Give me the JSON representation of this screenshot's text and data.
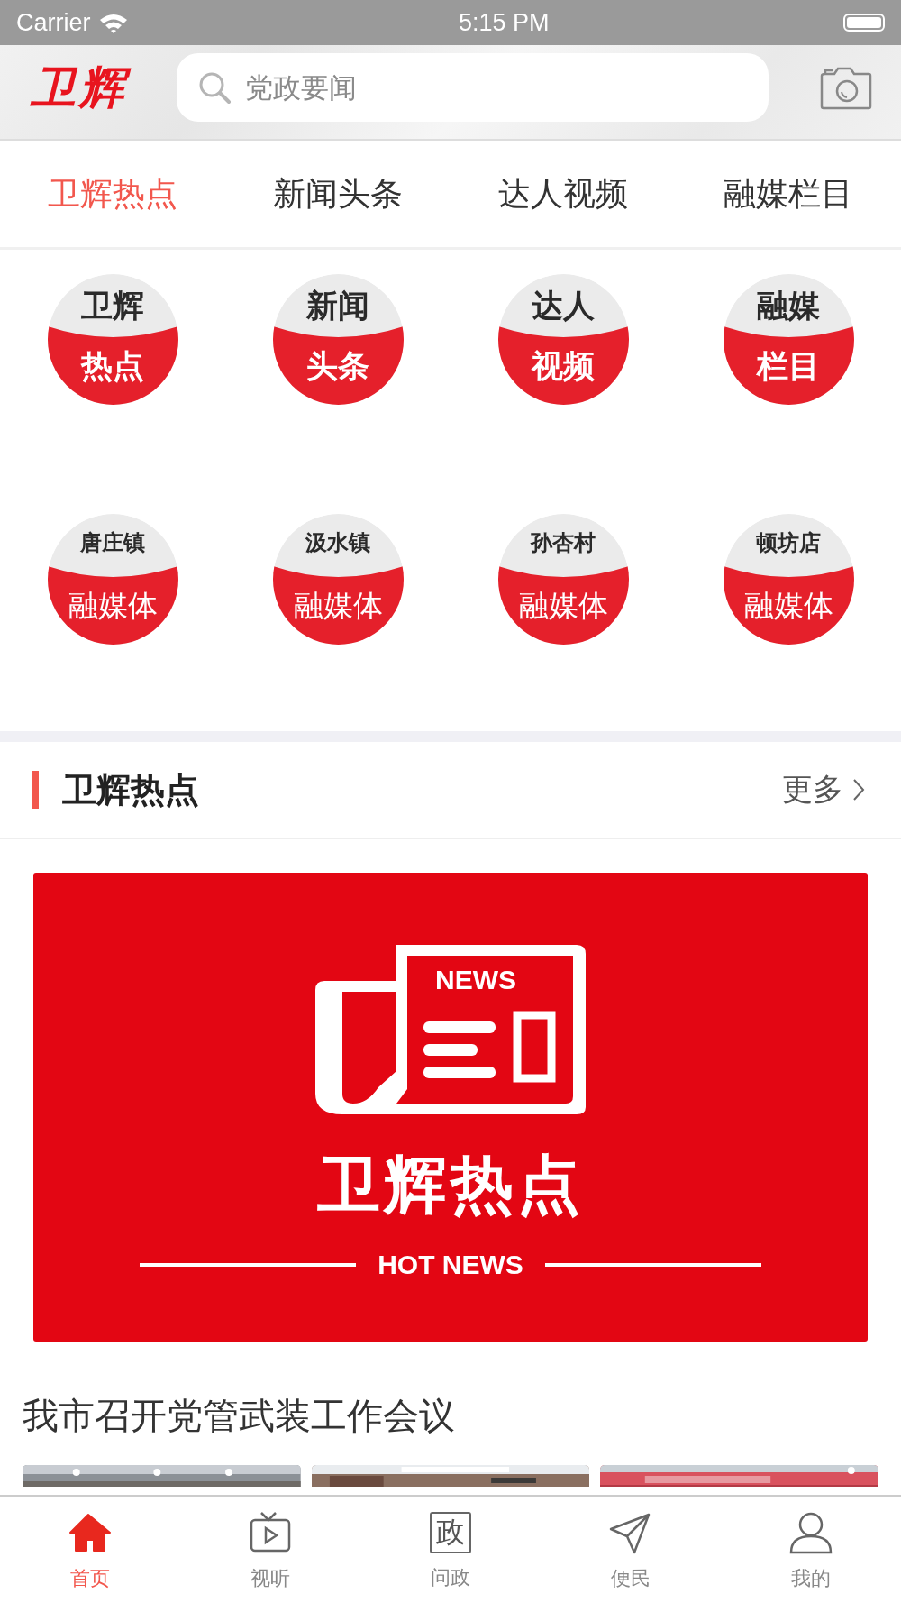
{
  "status_bar": {
    "carrier": "Carrier",
    "time": "5:15 PM"
  },
  "header": {
    "logo": "卫辉",
    "search": {
      "placeholder": "党政要闻"
    }
  },
  "tabs": [
    {
      "label": "卫辉热点",
      "selected": true
    },
    {
      "label": "新闻头条",
      "selected": false
    },
    {
      "label": "达人视频",
      "selected": false
    },
    {
      "label": "融媒栏目",
      "selected": false
    }
  ],
  "channels": [
    {
      "kind": "column",
      "top": "卫辉",
      "bottom": "热点"
    },
    {
      "kind": "column",
      "top": "新闻",
      "bottom": "头条"
    },
    {
      "kind": "column",
      "top": "达人",
      "bottom": "视频"
    },
    {
      "kind": "column",
      "top": "融媒",
      "bottom": "栏目"
    },
    {
      "kind": "town",
      "top": "唐庄镇",
      "bottom": "融媒体"
    },
    {
      "kind": "town",
      "top": "汲水镇",
      "bottom": "融媒体"
    },
    {
      "kind": "town",
      "top": "孙杏村",
      "bottom": "融媒体"
    },
    {
      "kind": "town",
      "top": "顿坊店",
      "bottom": "融媒体"
    }
  ],
  "section": {
    "title": "卫辉热点",
    "more": "更多"
  },
  "banner": {
    "badge": "NEWS",
    "title": "卫辉热点",
    "subtitle": "HOT NEWS"
  },
  "article": {
    "title": "我市召开党管武装工作会议"
  },
  "bottom_nav": [
    {
      "label": "首页",
      "selected": true
    },
    {
      "label": "视听",
      "selected": false
    },
    {
      "label": "问政",
      "selected": false,
      "glyph": "政"
    },
    {
      "label": "便民",
      "selected": false
    },
    {
      "label": "我的",
      "selected": false
    }
  ]
}
